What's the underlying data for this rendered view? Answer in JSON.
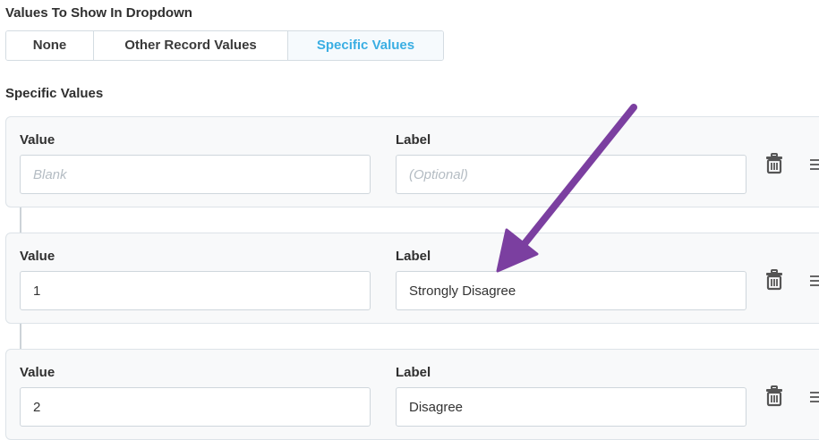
{
  "values_section": {
    "title": "Values To Show In Dropdown",
    "options": [
      {
        "label": "None",
        "active": false
      },
      {
        "label": "Other Record Values",
        "active": false
      },
      {
        "label": "Specific Values",
        "active": true
      }
    ]
  },
  "specific_section": {
    "title": "Specific Values",
    "rows": [
      {
        "value_label": "Value",
        "label_label": "Label",
        "value": "",
        "value_placeholder": "Blank",
        "label": "",
        "label_placeholder": "(Optional)"
      },
      {
        "value_label": "Value",
        "label_label": "Label",
        "value": "1",
        "value_placeholder": "",
        "label": "Strongly Disagree",
        "label_placeholder": ""
      },
      {
        "value_label": "Value",
        "label_label": "Label",
        "value": "2",
        "value_placeholder": "",
        "label": "Disagree",
        "label_placeholder": ""
      }
    ]
  },
  "icons": {
    "delete": "trash-icon",
    "reorder": "drag-handle-icon",
    "annotation": "arrow-annotation"
  },
  "colors": {
    "active_tab": "#3aaee3",
    "arrow": "#7b3fa0",
    "card_bg": "#f8f9fa",
    "border": "#d4dce2"
  }
}
